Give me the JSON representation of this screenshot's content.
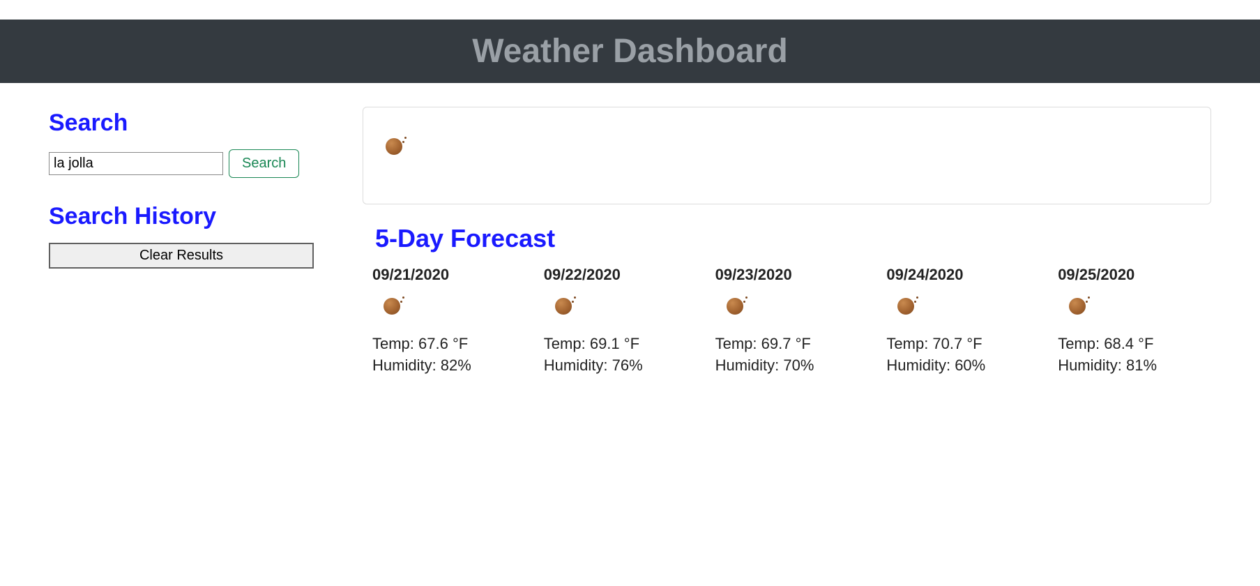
{
  "header": {
    "title": "Weather Dashboard"
  },
  "sidebar": {
    "search_heading": "Search",
    "search_value": "la jolla",
    "search_placeholder": "",
    "search_button": "Search",
    "history_heading": "Search History",
    "clear_button": "Clear Results"
  },
  "current": {
    "icon": "weather-icon"
  },
  "forecast": {
    "heading": "5-Day Forecast",
    "labels": {
      "temp_prefix": "Temp: ",
      "temp_suffix": " °F",
      "humidity_prefix": "Humidity: ",
      "humidity_suffix": "%"
    },
    "days": [
      {
        "date": "09/21/2020",
        "temp": "67.6",
        "humidity": "82"
      },
      {
        "date": "09/22/2020",
        "temp": "69.1",
        "humidity": "76"
      },
      {
        "date": "09/23/2020",
        "temp": "69.7",
        "humidity": "70"
      },
      {
        "date": "09/24/2020",
        "temp": "70.7",
        "humidity": "60"
      },
      {
        "date": "09/25/2020",
        "temp": "68.4",
        "humidity": "81"
      }
    ]
  }
}
